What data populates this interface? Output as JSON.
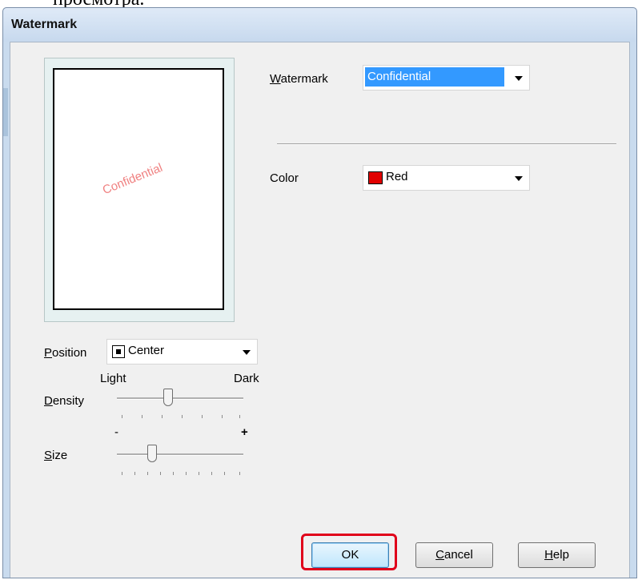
{
  "caption": "просмотра.",
  "window": {
    "title": "Watermark"
  },
  "preview": {
    "watermark_text": "Confidential"
  },
  "watermark": {
    "label_mnemonic": "W",
    "label_rest": "atermark",
    "value": "Confidential"
  },
  "color": {
    "label": "Color",
    "value": "Red",
    "swatch": "#e10000"
  },
  "position": {
    "label_mnemonic": "P",
    "label_rest": "osition",
    "value": "Center"
  },
  "density": {
    "label_mnemonic": "D",
    "label_rest": "ensity",
    "min_label": "Light",
    "max_label": "Dark",
    "level": 0.43
  },
  "size": {
    "label_mnemonic": "S",
    "label_rest": "ize",
    "min_label": "-",
    "max_label": "+",
    "level": 0.27
  },
  "buttons": {
    "ok": "OK",
    "cancel_mnemonic": "C",
    "cancel_rest": "ancel",
    "help_mnemonic": "H",
    "help_rest": "elp"
  },
  "colors": {
    "accent": "#3399ff",
    "highlight": "#e0001a",
    "watermark_preview": "#f08080"
  }
}
